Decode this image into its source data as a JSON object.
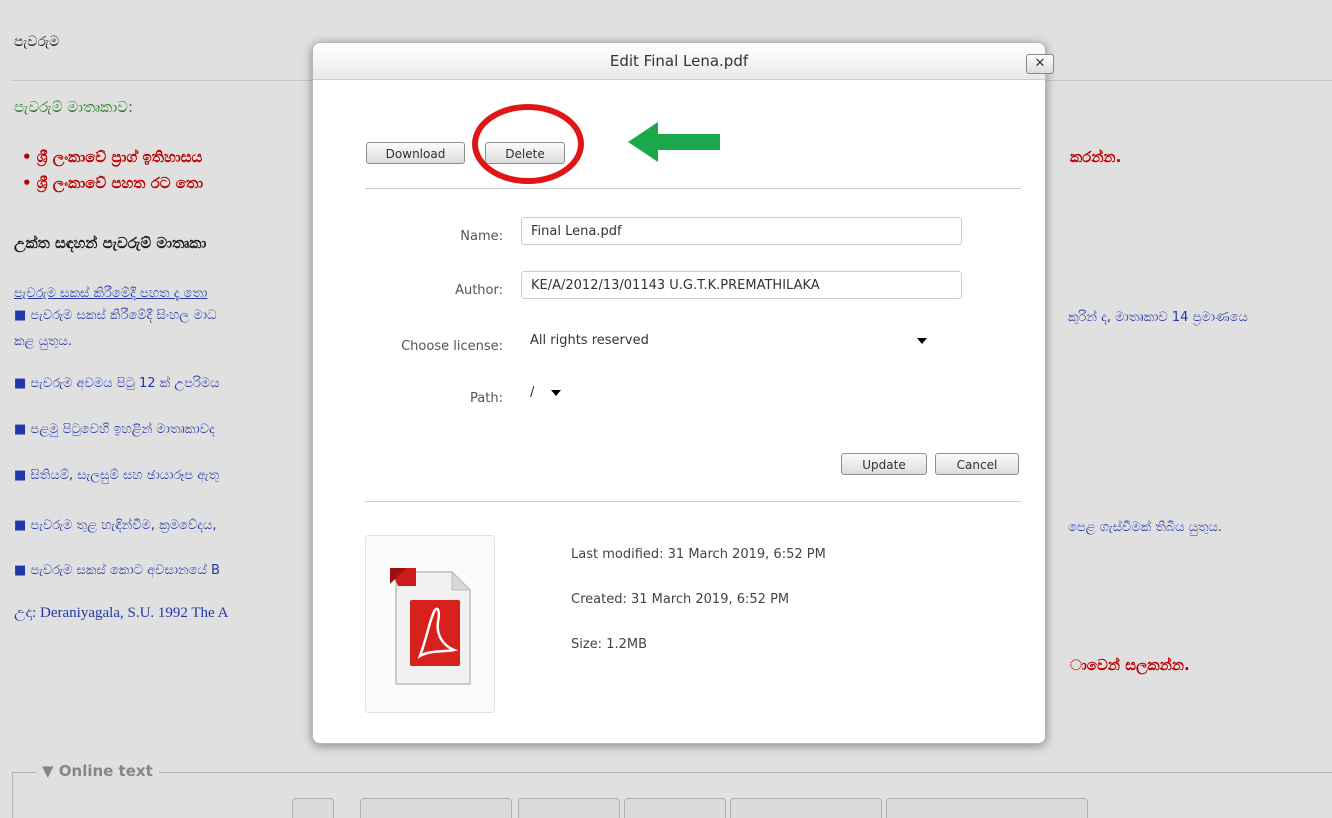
{
  "background": {
    "heading": "පැවරුම",
    "subtitle": "පැවරුම් මාතෘකාව:",
    "bullets": [
      "• ශ්‍රී ලංකාවේ ප්‍රාග් ඉතිහාසය",
      "• ශ්‍රී ලංකාවේ පහත රට තො"
    ],
    "bullet_right": "කරන්න.",
    "bold_line": "උක්ත සඳහන් පැවරුම් මාතෘකා",
    "notes": [
      "පැවරුම සකස් කිරීමේදී පහත දැ තො",
      "■ පැවරුම සකස් කිරීමේදී සිංහල මාධ",
      "කළ යුතුය.",
      "■ පැවරුම අවමය පිටු 12 ක් උපරිමය",
      "■ පළමු පිටුවෙහි ඉහළින් මාතෘකාවද",
      "■ සිතියම්, සැලසුම් සහ ඡායාරූප ඇතු",
      "■ පැවරුම තුළ හැඳින්වීම, ක්‍රමවේදය,",
      "■ පැවරුම සකස් කොට අවසානයේ B"
    ],
    "notes_right": [
      "කුරින් ද, මාතෘකාව 14 ප්‍රමාණයෙ",
      "පෙළ ගැස්වීමක් තිබිය යුතුය."
    ],
    "example": "උදා: Deraniyagala, S.U. 1992 The A",
    "bottom_right": "ාවෙන් සලකන්න.",
    "online_text_label": "▼ Online text"
  },
  "dialog": {
    "title": "Edit Final Lena.pdf",
    "close_label": "✕",
    "download_label": "Download",
    "delete_label": "Delete",
    "fields": {
      "name_label": "Name:",
      "name_value": "Final Lena.pdf",
      "author_label": "Author:",
      "author_value": "KE/A/2012/13/01143 U.G.T.K.PREMATHILAKA",
      "license_label": "Choose license:",
      "license_value": "All rights reserved",
      "path_label": "Path:",
      "path_value": "/"
    },
    "update_label": "Update",
    "cancel_label": "Cancel",
    "meta": {
      "last_modified": "Last modified: 31 March 2019, 6:52 PM",
      "created": "Created: 31 March 2019, 6:52 PM",
      "size": "Size: 1.2MB"
    },
    "file_icon": "pdf-file-icon"
  },
  "annotations": {
    "highlight_color": "#e01616",
    "arrow_color": "#1aa84a"
  }
}
